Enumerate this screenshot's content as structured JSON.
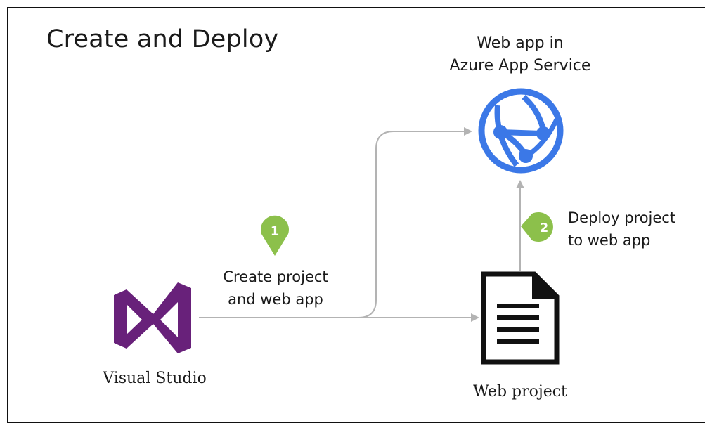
{
  "diagram": {
    "title": "Create and Deploy",
    "web_app": {
      "line1": "Web app in",
      "line2": "Azure App Service",
      "icon": "azure-web-app-icon"
    },
    "visual_studio": {
      "label": "Visual Studio",
      "icon": "visual-studio-icon"
    },
    "web_project": {
      "label": "Web project",
      "icon": "document-icon"
    },
    "step1": {
      "number": "1",
      "line1": "Create project",
      "line2": "and web app"
    },
    "step2": {
      "number": "2",
      "line1": "Deploy project",
      "line2": "to web app"
    },
    "colors": {
      "connector": "#b3b3b3",
      "step_badge": "#8cc04b",
      "azure_blue": "#3b78e7",
      "vs_purple": "#68217a",
      "document": "#111111"
    }
  }
}
